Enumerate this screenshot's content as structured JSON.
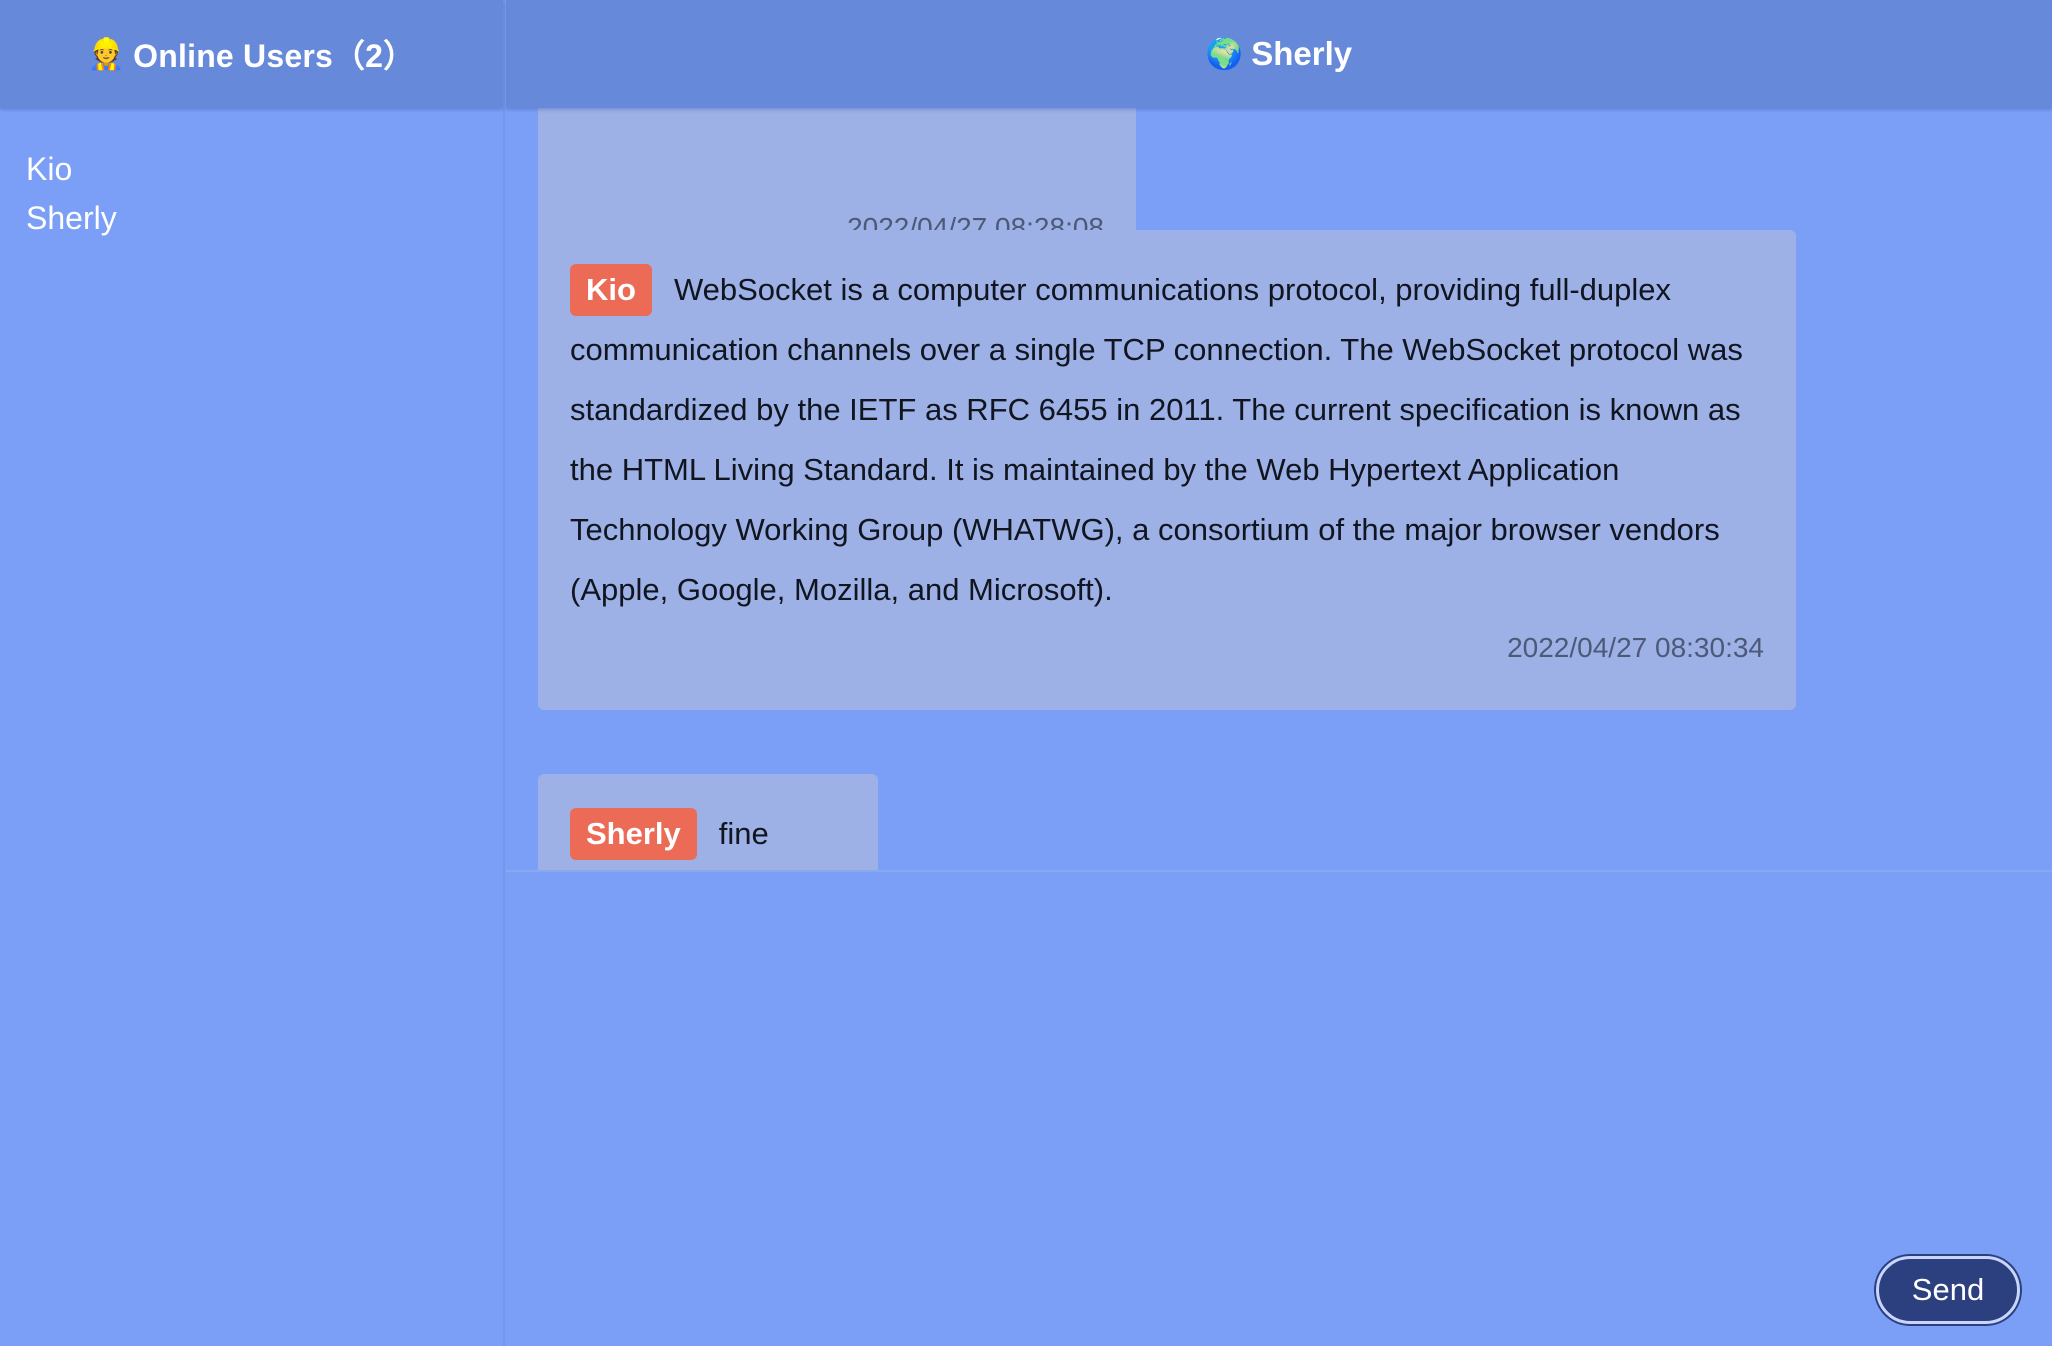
{
  "sidebar": {
    "header_emoji": "👷",
    "header_title": "Online Users（2）",
    "users": [
      "Kio",
      "Sherly"
    ]
  },
  "chat": {
    "header_emoji": "🌍",
    "header_title": "Sherly",
    "messages": [
      {
        "author": "",
        "text": "",
        "time": "2022/04/27 08:28:08"
      },
      {
        "author": "Kio",
        "text": "WebSocket is a computer communications protocol, providing full-duplex communication channels over a single TCP connection. The WebSocket protocol was standardized by the IETF as RFC 6455 in 2011. The current specification is known as the HTML Living Standard. It is maintained by the Web Hypertext Application Technology Working Group (WHATWG), a consortium of the major browser vendors (Apple, Google, Mozilla, and Microsoft).",
        "time": "2022/04/27 08:30:34"
      },
      {
        "author": "Sherly",
        "text": "fine",
        "time": ""
      }
    ]
  },
  "composer": {
    "value": "",
    "send_label": "Send"
  },
  "colors": {
    "background": "#7b9ff6",
    "header": "#6689d9",
    "bubble": "#9db1e6",
    "author_tag": "#ec6b57",
    "send_button": "#2c3f7e"
  }
}
